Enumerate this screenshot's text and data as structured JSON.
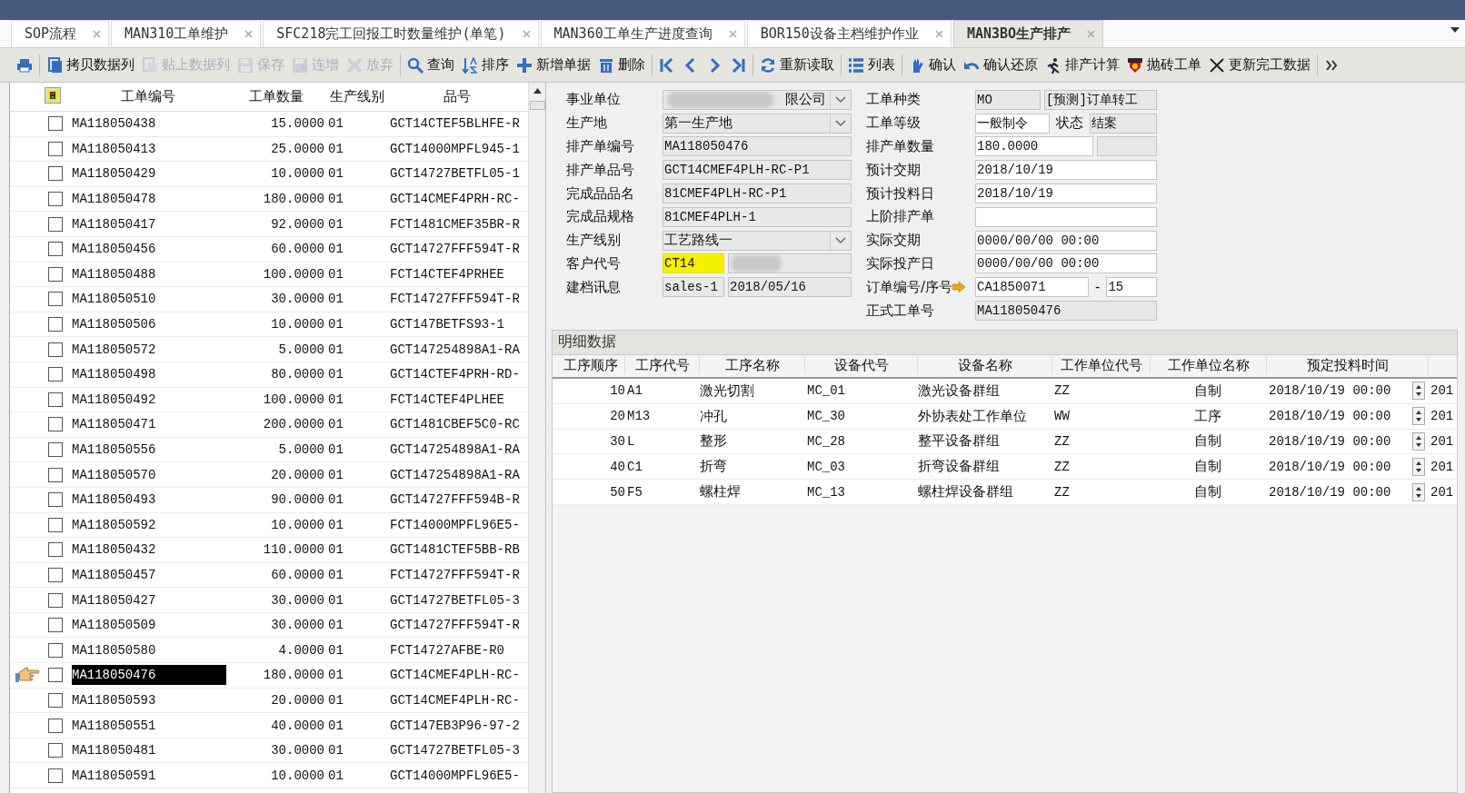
{
  "tabs": [
    {
      "label": "SOP流程",
      "selected": false
    },
    {
      "label": "MAN310工单维护",
      "selected": false
    },
    {
      "label": "SFC218完工回报工时数量维护(单笔)",
      "selected": false
    },
    {
      "label": "MAN360工单生产进度查询",
      "selected": false
    },
    {
      "label": "BOR150设备主档维护作业",
      "selected": false
    },
    {
      "label": "MAN3BO生产排产",
      "selected": true
    }
  ],
  "toolbar": [
    {
      "disabled": false
    },
    {
      "label": "拷贝数据列",
      "disabled": false
    },
    {
      "label": "贴上数据列",
      "disabled": true
    },
    {
      "label": "保存",
      "disabled": true
    },
    {
      "label": "连增",
      "disabled": true
    },
    {
      "label": "放弃",
      "disabled": true
    },
    {
      "label": "查询",
      "disabled": false
    },
    {
      "label": "排序",
      "disabled": false
    },
    {
      "label": "新增单据",
      "disabled": false
    },
    {
      "label": "删除",
      "disabled": false
    },
    {
      "disabled": false
    },
    {
      "disabled": false
    },
    {
      "disabled": false
    },
    {
      "disabled": false
    },
    {
      "label": "重新读取",
      "disabled": false
    },
    {
      "label": "列表",
      "disabled": false
    },
    {
      "label": "确认",
      "disabled": false
    },
    {
      "label": "确认还原",
      "disabled": false
    },
    {
      "label": "排产计算",
      "disabled": false
    },
    {
      "label": "抛砖工单",
      "disabled": false
    },
    {
      "label": "更新完工数据",
      "disabled": false
    },
    {
      "disabled": false
    }
  ],
  "list": {
    "columns": [
      "工单编号",
      "工单数量",
      "生产线别",
      "品号"
    ],
    "rows": [
      {
        "order": "MA118050438",
        "qty": "15.0000",
        "line": "01",
        "part": "GCT14CTEF5BLHFE-R",
        "checked": false,
        "selected": false
      },
      {
        "order": "MA118050413",
        "qty": "25.0000",
        "line": "01",
        "part": "GCT14000MPFL945-1",
        "checked": false,
        "selected": false
      },
      {
        "order": "MA118050429",
        "qty": "10.0000",
        "line": "01",
        "part": "GCT14727BETFL05-1",
        "checked": false,
        "selected": false
      },
      {
        "order": "MA118050478",
        "qty": "180.0000",
        "line": "01",
        "part": "GCT14CMEF4PRH-RC-",
        "checked": false,
        "selected": false
      },
      {
        "order": "MA118050417",
        "qty": "92.0000",
        "line": "01",
        "part": "FCT1481CMEF35BR-R",
        "checked": false,
        "selected": false
      },
      {
        "order": "MA118050456",
        "qty": "60.0000",
        "line": "01",
        "part": "GCT14727FFF594T-R",
        "checked": false,
        "selected": false
      },
      {
        "order": "MA118050488",
        "qty": "100.0000",
        "line": "01",
        "part": "FCT14CTEF4PRHEE",
        "checked": false,
        "selected": false
      },
      {
        "order": "MA118050510",
        "qty": "30.0000",
        "line": "01",
        "part": "FCT14727FFF594T-R",
        "checked": false,
        "selected": false
      },
      {
        "order": "MA118050506",
        "qty": "10.0000",
        "line": "01",
        "part": "GCT147BETFS93-1",
        "checked": false,
        "selected": false
      },
      {
        "order": "MA118050572",
        "qty": "5.0000",
        "line": "01",
        "part": "GCT147254898A1-RA",
        "checked": false,
        "selected": false
      },
      {
        "order": "MA118050498",
        "qty": "80.0000",
        "line": "01",
        "part": "GCT14CTEF4PRH-RD-",
        "checked": false,
        "selected": false
      },
      {
        "order": "MA118050492",
        "qty": "100.0000",
        "line": "01",
        "part": "FCT14CTEF4PLHEE",
        "checked": false,
        "selected": false
      },
      {
        "order": "MA118050471",
        "qty": "200.0000",
        "line": "01",
        "part": "GCT1481CBEF5C0-RC",
        "checked": false,
        "selected": false
      },
      {
        "order": "MA118050556",
        "qty": "5.0000",
        "line": "01",
        "part": "GCT147254898A1-RA",
        "checked": false,
        "selected": false
      },
      {
        "order": "MA118050570",
        "qty": "20.0000",
        "line": "01",
        "part": "GCT147254898A1-RA",
        "checked": false,
        "selected": false
      },
      {
        "order": "MA118050493",
        "qty": "90.0000",
        "line": "01",
        "part": "GCT14727FFF594B-R",
        "checked": false,
        "selected": false
      },
      {
        "order": "MA118050592",
        "qty": "10.0000",
        "line": "01",
        "part": "FCT14000MPFL96E5-",
        "checked": false,
        "selected": false
      },
      {
        "order": "MA118050432",
        "qty": "110.0000",
        "line": "01",
        "part": "GCT1481CTEF5BB-RB",
        "checked": false,
        "selected": false
      },
      {
        "order": "MA118050457",
        "qty": "60.0000",
        "line": "01",
        "part": "FCT14727FFF594T-R",
        "checked": false,
        "selected": false
      },
      {
        "order": "MA118050427",
        "qty": "30.0000",
        "line": "01",
        "part": "GCT14727BETFL05-3",
        "checked": false,
        "selected": false
      },
      {
        "order": "MA118050509",
        "qty": "30.0000",
        "line": "01",
        "part": "GCT14727FFF594T-R",
        "checked": false,
        "selected": false
      },
      {
        "order": "MA118050580",
        "qty": "4.0000",
        "line": "01",
        "part": "FCT14727AFBE-R0",
        "checked": false,
        "selected": false
      },
      {
        "order": "MA118050476",
        "qty": "180.0000",
        "line": "01",
        "part": "GCT14CMEF4PLH-RC-",
        "checked": false,
        "selected": true
      },
      {
        "order": "MA118050593",
        "qty": "20.0000",
        "line": "01",
        "part": "GCT14CMEF4PLH-RC-",
        "checked": false,
        "selected": false
      },
      {
        "order": "MA118050551",
        "qty": "40.0000",
        "line": "01",
        "part": "GCT147EB3P96-97-2",
        "checked": false,
        "selected": false
      },
      {
        "order": "MA118050481",
        "qty": "30.0000",
        "line": "01",
        "part": "GCT14727BETFL05-3",
        "checked": false,
        "selected": false
      },
      {
        "order": "MA118050591",
        "qty": "10.0000",
        "line": "01",
        "part": "GCT14000MPFL96E5-",
        "checked": false,
        "selected": false
      }
    ]
  },
  "form": {
    "left": [
      {
        "label": "事业单位",
        "fields": [
          {
            "kind": "combo",
            "value": "限公司",
            "readonly": true,
            "blurred": true
          }
        ]
      },
      {
        "label": "生产地",
        "fields": [
          {
            "kind": "combo",
            "value": "第一生产地",
            "readonly": true
          }
        ]
      },
      {
        "label": "排产单编号",
        "fields": [
          {
            "kind": "text",
            "value": "MA118050476",
            "readonly": true
          }
        ]
      },
      {
        "label": "排产单品号",
        "fields": [
          {
            "kind": "text",
            "value": "GCT14CMEF4PLH-RC-P1",
            "readonly": true
          }
        ]
      },
      {
        "label": "完成品品名",
        "fields": [
          {
            "kind": "text",
            "value": "81CMEF4PLH-RC-P1",
            "readonly": true
          }
        ]
      },
      {
        "label": "完成品规格",
        "fields": [
          {
            "kind": "text",
            "value": "81CMEF4PLH-1",
            "readonly": true
          }
        ]
      },
      {
        "label": "生产线别",
        "fields": [
          {
            "kind": "combo",
            "value": "工艺路线一",
            "readonly": true
          }
        ]
      },
      {
        "label": "客户代号",
        "fields": [
          {
            "kind": "text",
            "value": "CT14",
            "readonly": true,
            "highlighted": true
          },
          {
            "kind": "text",
            "readonly": true,
            "blurred": true
          }
        ]
      },
      {
        "label": "建档讯息",
        "fields": [
          {
            "kind": "text",
            "value": "sales-1",
            "readonly": true
          },
          {
            "kind": "text",
            "value": "2018/05/16",
            "readonly": true
          }
        ]
      }
    ],
    "right": [
      {
        "label": "工单种类",
        "fields": [
          {
            "kind": "text",
            "value": "MO",
            "readonly": true
          },
          {
            "kind": "text",
            "value": "[预测]订单转工",
            "readonly": true
          }
        ]
      },
      {
        "label": "工单等级",
        "fields": [
          {
            "kind": "text",
            "value": "一般制令",
            "readonly": false
          },
          {
            "kind": "label",
            "value": "状态"
          },
          {
            "kind": "text",
            "value": "结案",
            "readonly": true
          }
        ]
      },
      {
        "label": "排产单数量",
        "fields": [
          {
            "kind": "number",
            "value": "180.0000",
            "readonly": false
          },
          {
            "kind": "text",
            "readonly": true
          }
        ]
      },
      {
        "label": "预计交期",
        "fields": [
          {
            "kind": "text",
            "value": "2018/10/19",
            "readonly": false
          }
        ]
      },
      {
        "label": "预计投料日",
        "fields": [
          {
            "kind": "text",
            "value": "2018/10/19",
            "readonly": false
          }
        ]
      },
      {
        "label": "上阶排产单",
        "fields": [
          {
            "kind": "text",
            "readonly": false
          }
        ]
      },
      {
        "label": "实际交期",
        "fields": [
          {
            "kind": "text",
            "value": "0000/00/00 00:00",
            "readonly": false
          }
        ]
      },
      {
        "label": "实际投产日",
        "fields": [
          {
            "kind": "text",
            "value": "0000/00/00 00:00",
            "readonly": false
          }
        ]
      },
      {
        "label": "订单编号/序号",
        "link_arrow": true,
        "fields": [
          {
            "kind": "text",
            "value": "CA1850071",
            "readonly": false
          },
          {
            "kind": "label",
            "value": "-"
          },
          {
            "kind": "text",
            "value": "15",
            "readonly": false
          }
        ]
      },
      {
        "label": "正式工单号",
        "fields": [
          {
            "kind": "text",
            "value": "MA118050476",
            "readonly": true
          }
        ]
      }
    ]
  },
  "detail": {
    "title": "明细数据",
    "columns": [
      "工序顺序",
      "工序代号",
      "工序名称",
      "设备代号",
      "设备名称",
      "工作单位代号",
      "工作单位名称",
      "预定投料时间"
    ],
    "rows": [
      {
        "seq": "10",
        "op_code": "A1",
        "op_name": "激光切割",
        "eq_code": "MC_01",
        "eq_name": "激光设备群组",
        "unit_code": "ZZ",
        "unit_name": "自制",
        "start_time": "2018/10/19 00:00",
        "column_9": "201"
      },
      {
        "seq": "20",
        "op_code": "M13",
        "op_name": "冲孔",
        "eq_code": "MC_30",
        "eq_name": "外协表处工作单位",
        "unit_code": "WW",
        "unit_name": "工序",
        "start_time": "2018/10/19 00:00",
        "column_9": "201"
      },
      {
        "seq": "30",
        "op_code": "L",
        "op_name": "整形",
        "eq_code": "MC_28",
        "eq_name": "整平设备群组",
        "unit_code": "ZZ",
        "unit_name": "自制",
        "start_time": "2018/10/19 00:00",
        "column_9": "201"
      },
      {
        "seq": "40",
        "op_code": "C1",
        "op_name": "折弯",
        "eq_code": "MC_03",
        "eq_name": "折弯设备群组",
        "unit_code": "ZZ",
        "unit_name": "自制",
        "start_time": "2018/10/19 00:00",
        "column_9": "201"
      },
      {
        "seq": "50",
        "op_code": "F5",
        "op_name": "螺柱焊",
        "eq_code": "MC_13",
        "eq_name": "螺柱焊设备群组",
        "unit_code": "ZZ",
        "unit_name": "自制",
        "start_time": "2018/10/19 00:00",
        "column_9": "201"
      }
    ]
  }
}
